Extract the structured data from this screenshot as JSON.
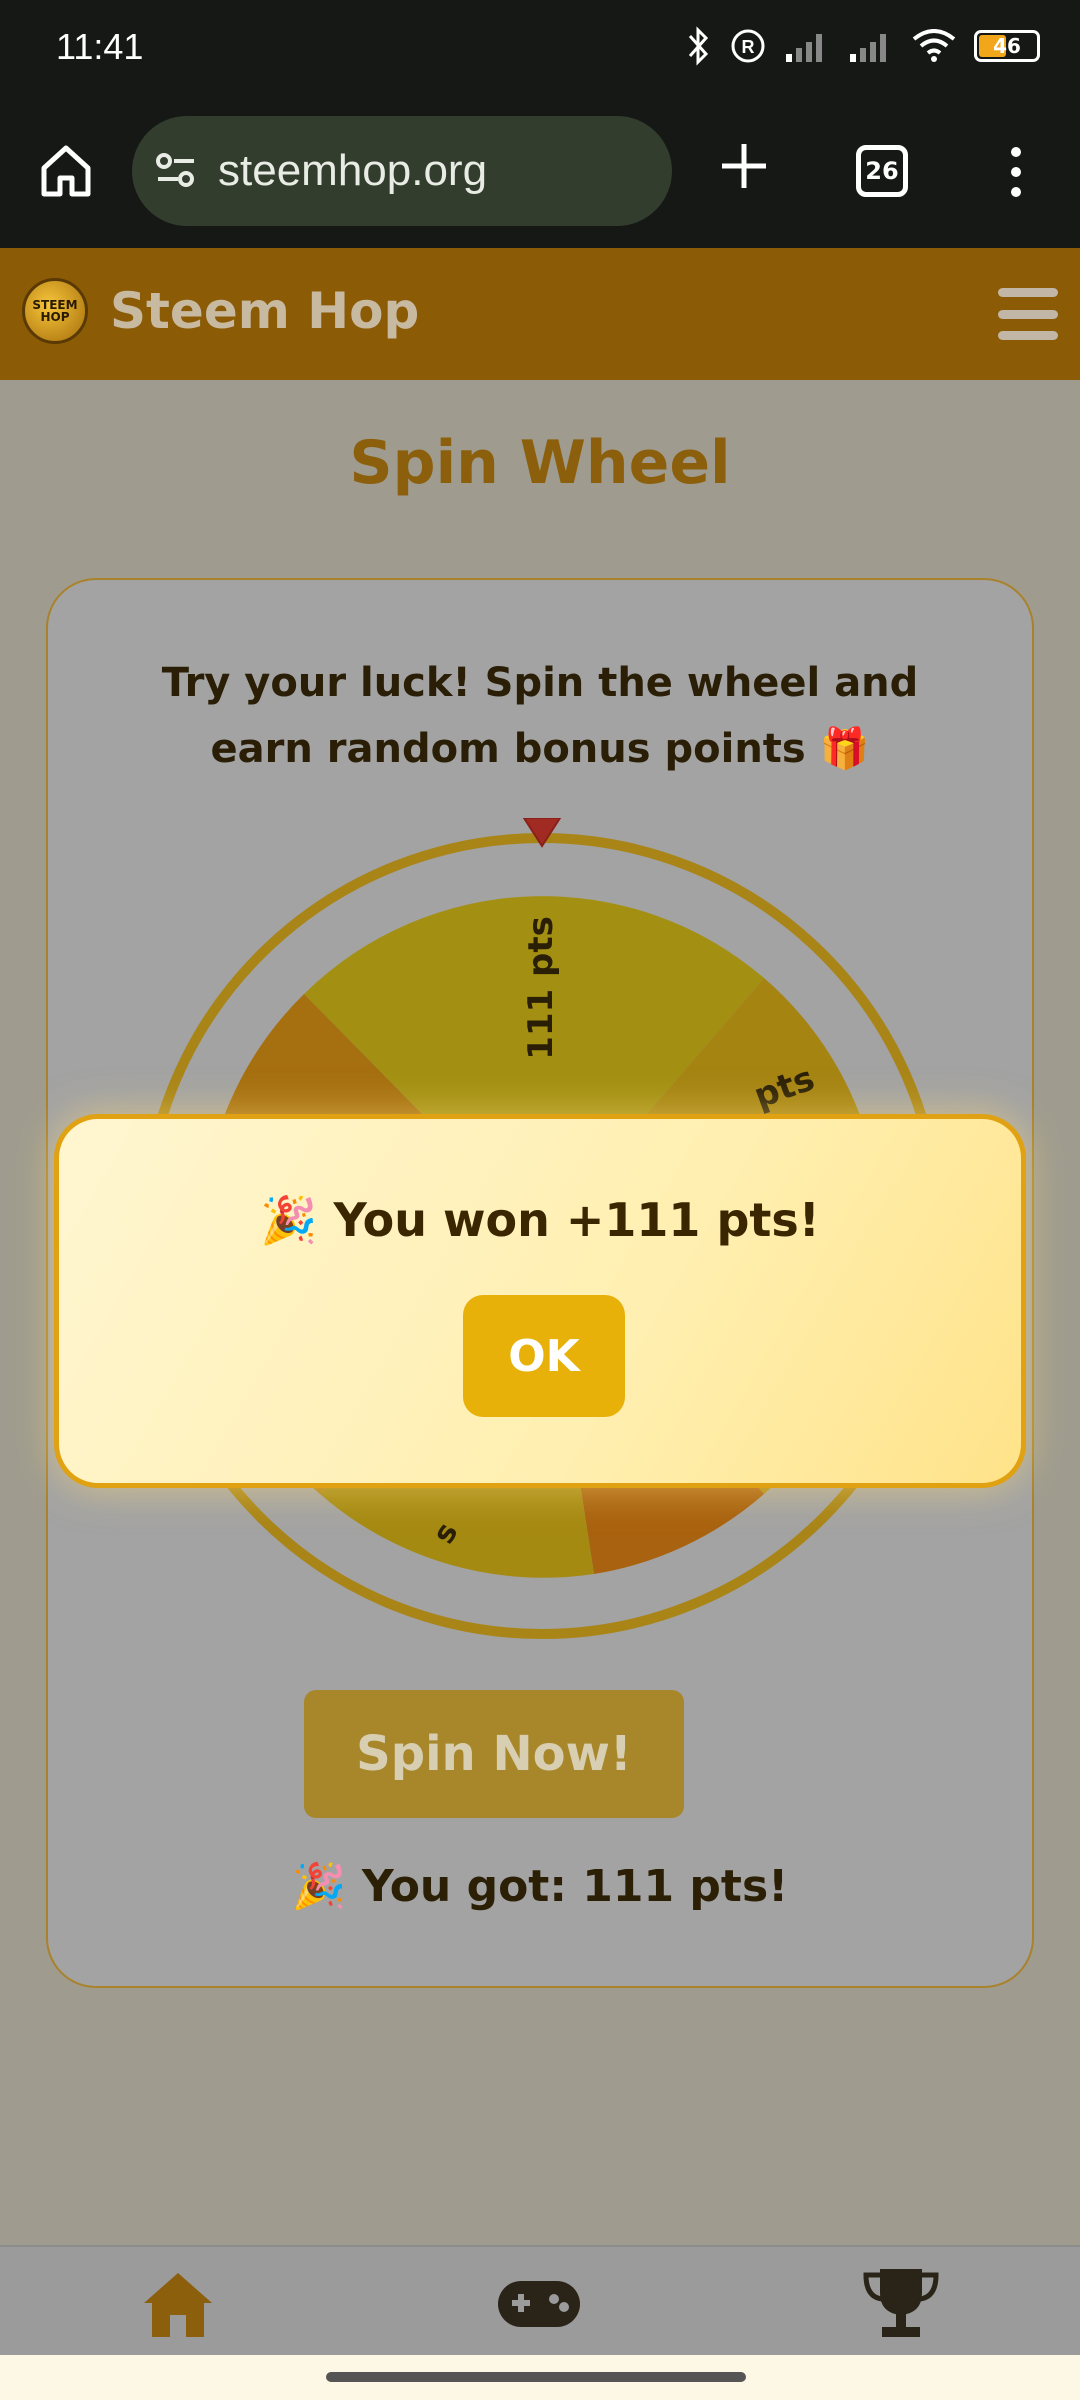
{
  "status_bar": {
    "time": "11:41",
    "battery": "46"
  },
  "browser": {
    "url": "steemhop.org",
    "tab_count": "26"
  },
  "site": {
    "title": "Steem Hop",
    "logo_text": "STEEM HOP"
  },
  "page": {
    "title": "Spin Wheel",
    "intro": "Try your luck! Spin the wheel and earn random bonus points 🎁",
    "wheel_labels": [
      "111 pts",
      "pts",
      "s"
    ],
    "spin_button": "Spin Now!",
    "result": "🎉 You got: 111 pts!"
  },
  "modal": {
    "message": "🎉 You won +111 pts!",
    "ok_label": "OK"
  },
  "colors": {
    "accent": "#e7b109",
    "header": "#8b5b06",
    "title": "#8c5f0c"
  },
  "icons": {
    "nav": [
      "home-icon",
      "gamepad-icon",
      "trophy-icon"
    ]
  }
}
